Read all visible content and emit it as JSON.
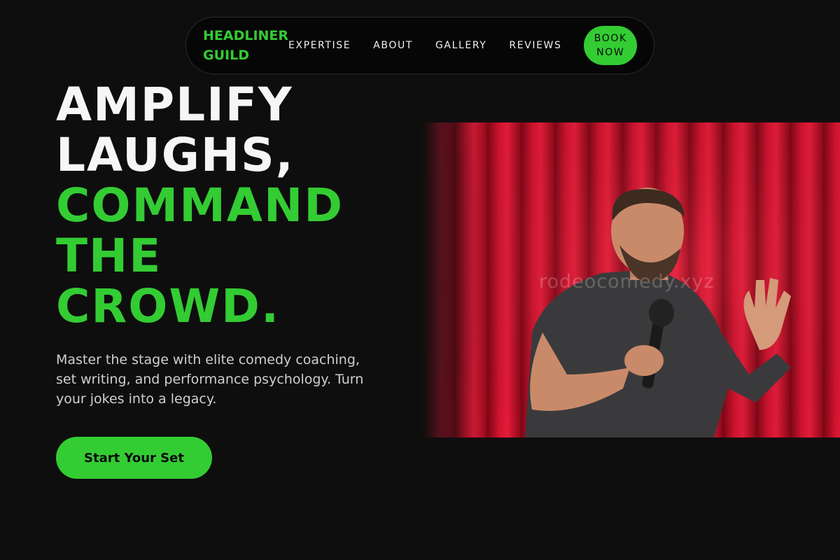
{
  "brand": {
    "line1": "HEADLINER",
    "line2": "GUILD"
  },
  "nav": {
    "links": [
      "EXPERTISE",
      "ABOUT",
      "GALLERY",
      "REVIEWS"
    ],
    "book_line1": "BOOK",
    "book_line2": "NOW"
  },
  "hero": {
    "title_white": [
      "AMPLIFY",
      "LAUGHS,"
    ],
    "title_green": [
      "COMMAND",
      "THE",
      "CROWD."
    ],
    "subtitle": "Master the stage with elite comedy coaching, set writing, and performance psychology. Turn your jokes into a legacy.",
    "cta_label": "Start Your Set",
    "image_watermark": "rodeocomedy.xyz"
  },
  "colors": {
    "accent": "#33cc33",
    "background": "#0e0e0e",
    "nav_background": "#060606",
    "curtain": "#c8102e"
  }
}
